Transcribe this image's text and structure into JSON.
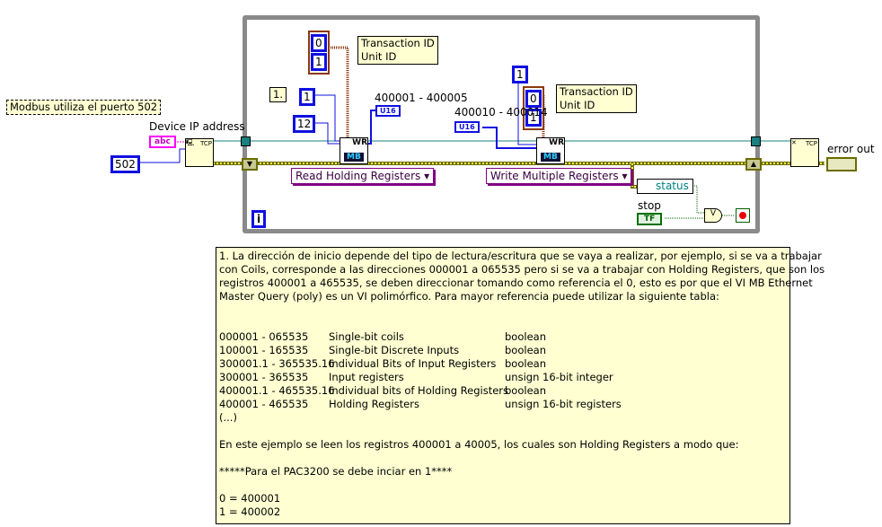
{
  "left": {
    "port_note": "Modbus utiliza el puerto 502",
    "ip_label": "Device IP address",
    "ip_control": "abc",
    "port_value": "502",
    "open_vi": "TCP"
  },
  "loop": {
    "iteration": "i",
    "step_note": "1.",
    "read": {
      "starting_address": "1",
      "quantity": "12",
      "ids": [
        "0",
        "1"
      ],
      "ids_note": [
        "Transaction ID",
        "Unit ID"
      ],
      "vi_label": "WR",
      "vi_badge": "MB",
      "range_label": "400001 - 400005",
      "output_type": "U16",
      "mode": "Read Holding Registers"
    },
    "write": {
      "starting_address": "1",
      "ids": [
        "0",
        "1"
      ],
      "ids_note": [
        "Transaction ID",
        "Unit ID"
      ],
      "vi_label": "WR",
      "vi_badge": "MB",
      "range_label": "400010 - 400014",
      "input_type": "U16",
      "mode": "Write Multiple Registers"
    },
    "status_label": "status",
    "stop_label": "stop",
    "stop_control": "TF",
    "or_symbol": "V"
  },
  "right": {
    "close_vi": "TCP",
    "error_out_label": "error out"
  },
  "comment": {
    "intro": [
      "1. La dirección de inicio depende del tipo de lectura/escritura que se vaya a realizar, por ejemplo, si se va a trabajar",
      "con Coils, corresponde a las direcciones 000001 a 065535 pero si se va a trabajar con Holding Registers, que son los",
      "registros 400001 a 465535, se deben direccionar tomando como referencia el 0, esto es por que el VI MB Ethernet",
      "Master Query (poly) es un VI polimórfico. Para mayor referencia puede utilizar la siguiente tabla:"
    ],
    "table": [
      [
        "000001 - 065535",
        "Single-bit coils",
        "boolean"
      ],
      [
        "100001 - 165535",
        "Single-bit Discrete Inputs",
        "boolean"
      ],
      [
        "300001.1 - 365535.16",
        "Individual Bits of Input Registers",
        "boolean"
      ],
      [
        "300001 - 365535",
        "Input registers",
        "unsign 16-bit integer"
      ],
      [
        "400001.1 - 465535.16",
        "Individual bits of Holding Registers",
        "boolean"
      ],
      [
        "400001 - 465535",
        "Holding Registers",
        "unsign 16-bit registers"
      ]
    ],
    "ellipsis": "(...)",
    "example": "En este ejemplo se leen los registros 400001 a 40005, los cuales son Holding Registers a modo que:",
    "pac": "*****Para el PAC3200 se debe inciar en 1****",
    "map": [
      "0 = 400001",
      "1 = 400002"
    ]
  }
}
